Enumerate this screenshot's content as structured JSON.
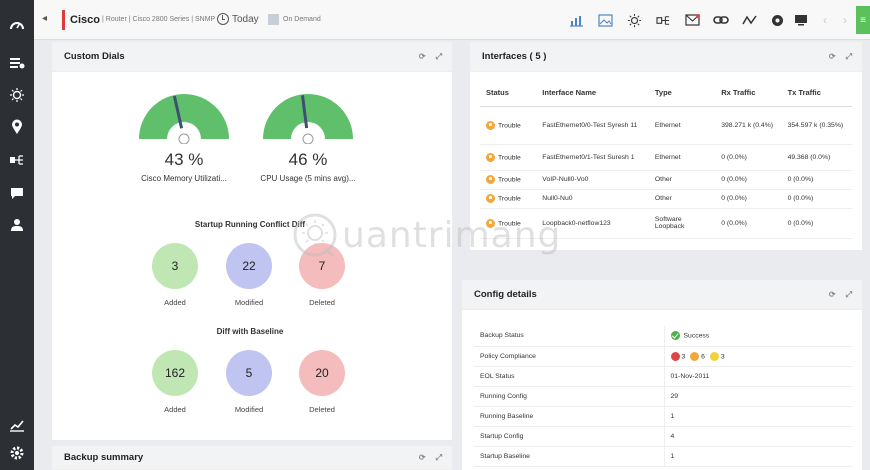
{
  "topbar": {
    "device_name": "Cisco",
    "device_breadcrumb": "| Router | Cisco 2800 Series | SNMP",
    "today_label": "Today",
    "on_demand_label": "On Demand",
    "menu_glyph": "≡"
  },
  "custom_dials": {
    "title": "Custom Dials",
    "dials": [
      {
        "value_text": "43 %",
        "value": 43,
        "label": "Cisco Memory Utilizati..."
      },
      {
        "value_text": "46 %",
        "value": 46,
        "label": "CPU Usage (5 mins avg)..."
      }
    ],
    "startup_running": {
      "title": "Startup Running Conflict Diff",
      "added": "3",
      "modified": "22",
      "deleted": "7",
      "added_label": "Added",
      "modified_label": "Modified",
      "deleted_label": "Deleted"
    },
    "baseline": {
      "title": "Diff with Baseline",
      "added": "162",
      "modified": "5",
      "deleted": "20",
      "added_label": "Added",
      "modified_label": "Modified",
      "deleted_label": "Deleted"
    }
  },
  "backup_summary": {
    "title": "Backup summary"
  },
  "interfaces": {
    "title": "Interfaces ( 5 )",
    "columns": [
      "Status",
      "Interface Name",
      "Type",
      "Rx Traffic",
      "Tx Traffic"
    ],
    "rows": [
      {
        "status": "Trouble",
        "name": "FastEthernet0/0-Test Syresh 11",
        "type": "Ethernet",
        "rx": "398.271 k (0.4%)",
        "tx": "354.597 k (0.35%)"
      },
      {
        "status": "Trouble",
        "name": "FastEthernet0/1-Test Suresh 1",
        "type": "Ethernet",
        "rx": "0 (0.0%)",
        "tx": "49.368 (0.0%)"
      },
      {
        "status": "Trouble",
        "name": "VoIP-Null0-Vo0",
        "type": "Other",
        "rx": "0 (0.0%)",
        "tx": "0 (0.0%)"
      },
      {
        "status": "Trouble",
        "name": "Null0-Nu0",
        "type": "Other",
        "rx": "0 (0.0%)",
        "tx": "0 (0.0%)"
      },
      {
        "status": "Trouble",
        "name": "Loopback0-netflow123",
        "type": "Software Loopback",
        "rx": "0 (0.0%)",
        "tx": "0 (0.0%)"
      }
    ]
  },
  "config": {
    "title": "Config details",
    "backup_status_label": "Backup Status",
    "backup_status": "Success",
    "policy_label": "Policy Compliance",
    "policy_red": "3",
    "policy_orange": "6",
    "policy_yellow": "3",
    "eol_label": "EOL Status",
    "eol": "01-Nov-2011",
    "running_config_label": "Running Config",
    "running_config": "29",
    "running_baseline_label": "Running Baseline",
    "running_baseline": "1",
    "startup_config_label": "Startup Config",
    "startup_config": "4",
    "startup_baseline_label": "Startup Baseline",
    "startup_baseline": "1"
  },
  "watermark": "uantrimang",
  "colors": {
    "dial_fill": "#5fbf6b",
    "trouble": "#f3a73b",
    "success": "#4cae4c",
    "added": "#bfe6b3",
    "modified": "#c0c4f0",
    "deleted": "#f4bcbc"
  }
}
